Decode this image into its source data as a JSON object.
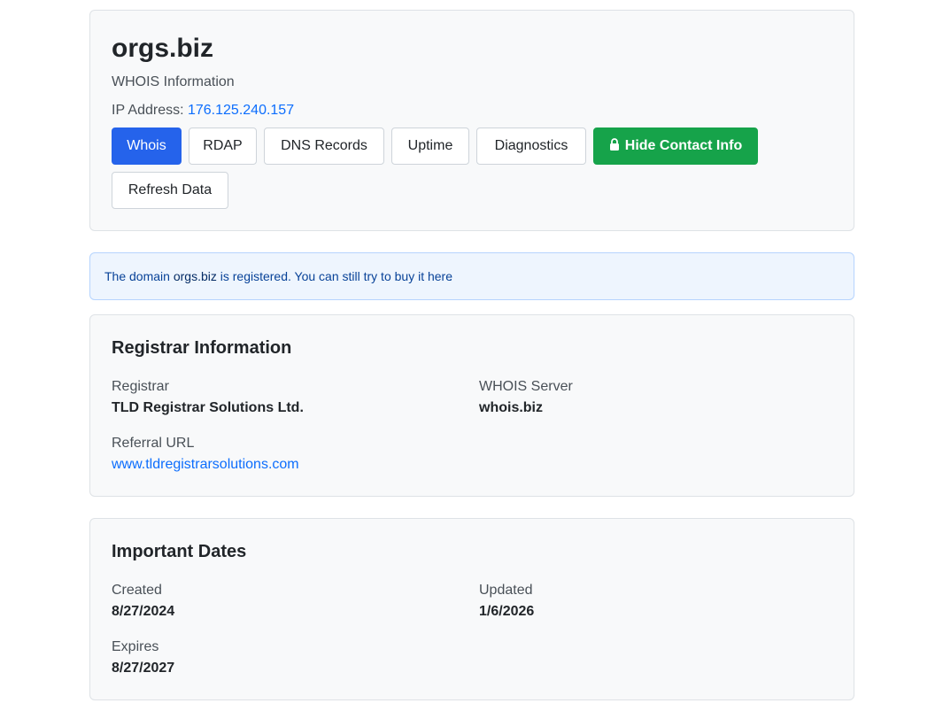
{
  "header": {
    "domain": "orgs.biz",
    "subtitle": "WHOIS Information",
    "ip_label": "IP Address:",
    "ip_value": "176.125.240.157"
  },
  "buttons": {
    "whois": "Whois",
    "rdap": "RDAP",
    "dns": "DNS Records",
    "uptime": "Uptime",
    "diagnostics": "Diagnostics",
    "hide_contact": "Hide Contact Info",
    "refresh": "Refresh Data"
  },
  "alert": {
    "prefix": "The domain",
    "domain": "orgs.biz",
    "middle": "is registered. You can still try to buy it",
    "link": "here",
    "suffix": "."
  },
  "registrar": {
    "title": "Registrar Information",
    "registrar_label": "Registrar",
    "registrar_value": "TLD Registrar Solutions Ltd.",
    "whois_server_label": "WHOIS Server",
    "whois_server_value": "whois.biz",
    "referral_label": "Referral URL",
    "referral_value": "www.tldregistrarsolutions.com"
  },
  "dates": {
    "title": "Important Dates",
    "created_label": "Created",
    "created_value": "8/27/2024",
    "updated_label": "Updated",
    "updated_value": "1/6/2026",
    "expires_label": "Expires",
    "expires_value": "8/27/2027"
  },
  "colors": {
    "primary": "#2563eb",
    "success": "#16a34a",
    "link": "#0d6efd",
    "alert_bg": "#eef5fe"
  }
}
